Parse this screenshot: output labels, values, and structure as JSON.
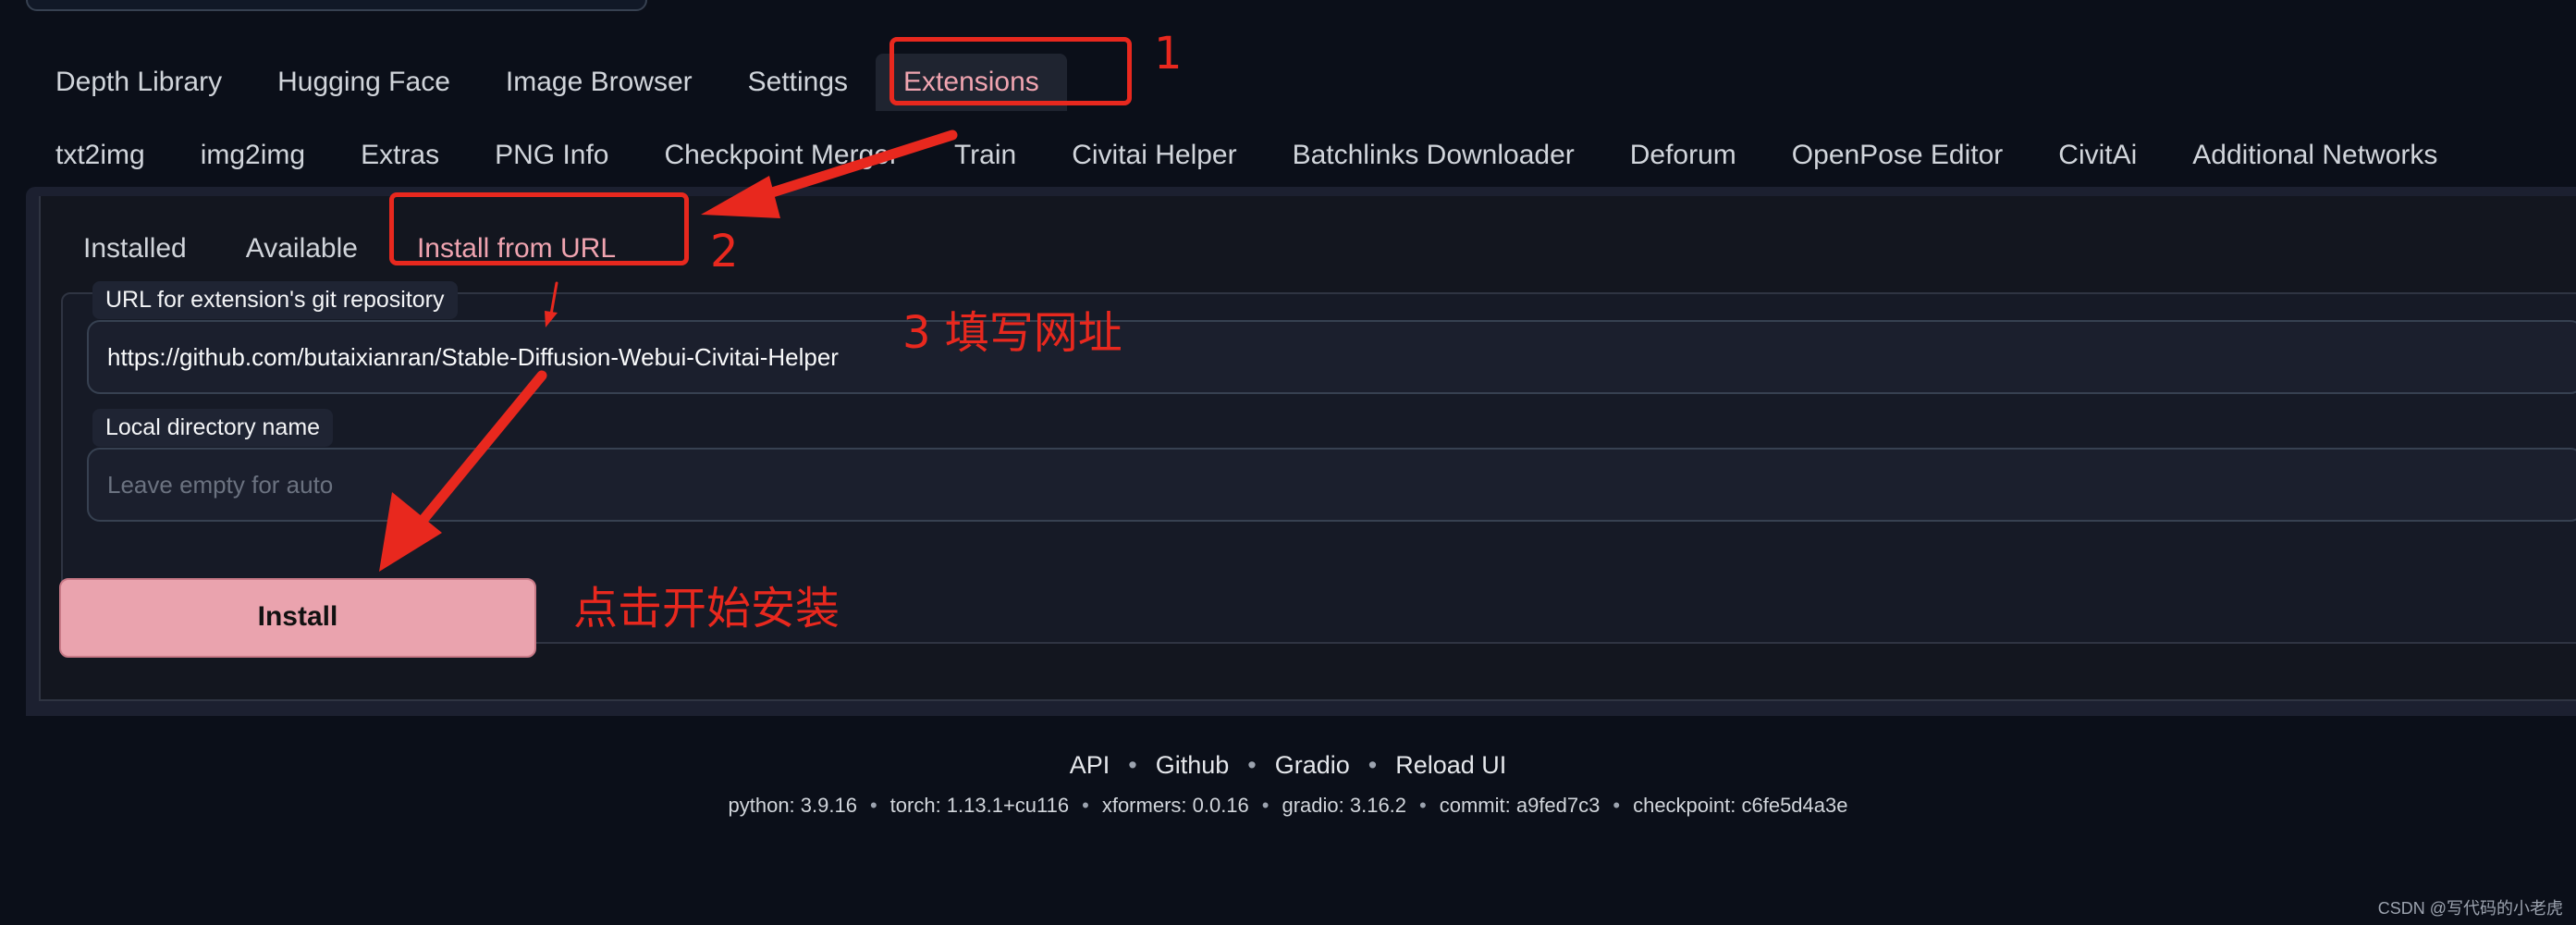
{
  "top_tabs": [
    {
      "label": "Depth Library",
      "active": false
    },
    {
      "label": "Hugging Face",
      "active": false
    },
    {
      "label": "Image Browser",
      "active": false
    },
    {
      "label": "Settings",
      "active": false
    },
    {
      "label": "Extensions",
      "active": true
    }
  ],
  "second_tabs": [
    {
      "label": "txt2img"
    },
    {
      "label": "img2img"
    },
    {
      "label": "Extras"
    },
    {
      "label": "PNG Info"
    },
    {
      "label": "Checkpoint Merger"
    },
    {
      "label": "Train"
    },
    {
      "label": "Civitai Helper"
    },
    {
      "label": "Batchlinks Downloader"
    },
    {
      "label": "Deforum"
    },
    {
      "label": "OpenPose Editor"
    },
    {
      "label": "CivitAi"
    },
    {
      "label": "Additional Networks"
    }
  ],
  "extensions": {
    "sub_tabs": [
      {
        "label": "Installed",
        "active": false
      },
      {
        "label": "Available",
        "active": false
      },
      {
        "label": "Install from URL",
        "active": true
      }
    ],
    "url_label": "URL for extension's git repository",
    "url_value": "https://github.com/butaixianran/Stable-Diffusion-Webui-Civitai-Helper",
    "dir_label": "Local directory name",
    "dir_placeholder": "Leave empty for auto",
    "install_label": "Install"
  },
  "footer": {
    "links": [
      "API",
      "Github",
      "Gradio",
      "Reload UI"
    ],
    "info": [
      "python: 3.9.16",
      "torch: 1.13.1+cu116",
      "xformers: 0.0.16",
      "gradio: 3.16.2",
      "commit: a9fed7c3",
      "checkpoint: c6fe5d4a3e"
    ],
    "separator": "•"
  },
  "annotations": {
    "step1": "1",
    "step2": "2",
    "step3": "3 填写网址",
    "step4": "点击开始安装",
    "color": "#e8281e"
  },
  "watermark": "CSDN @写代码的小老虎"
}
